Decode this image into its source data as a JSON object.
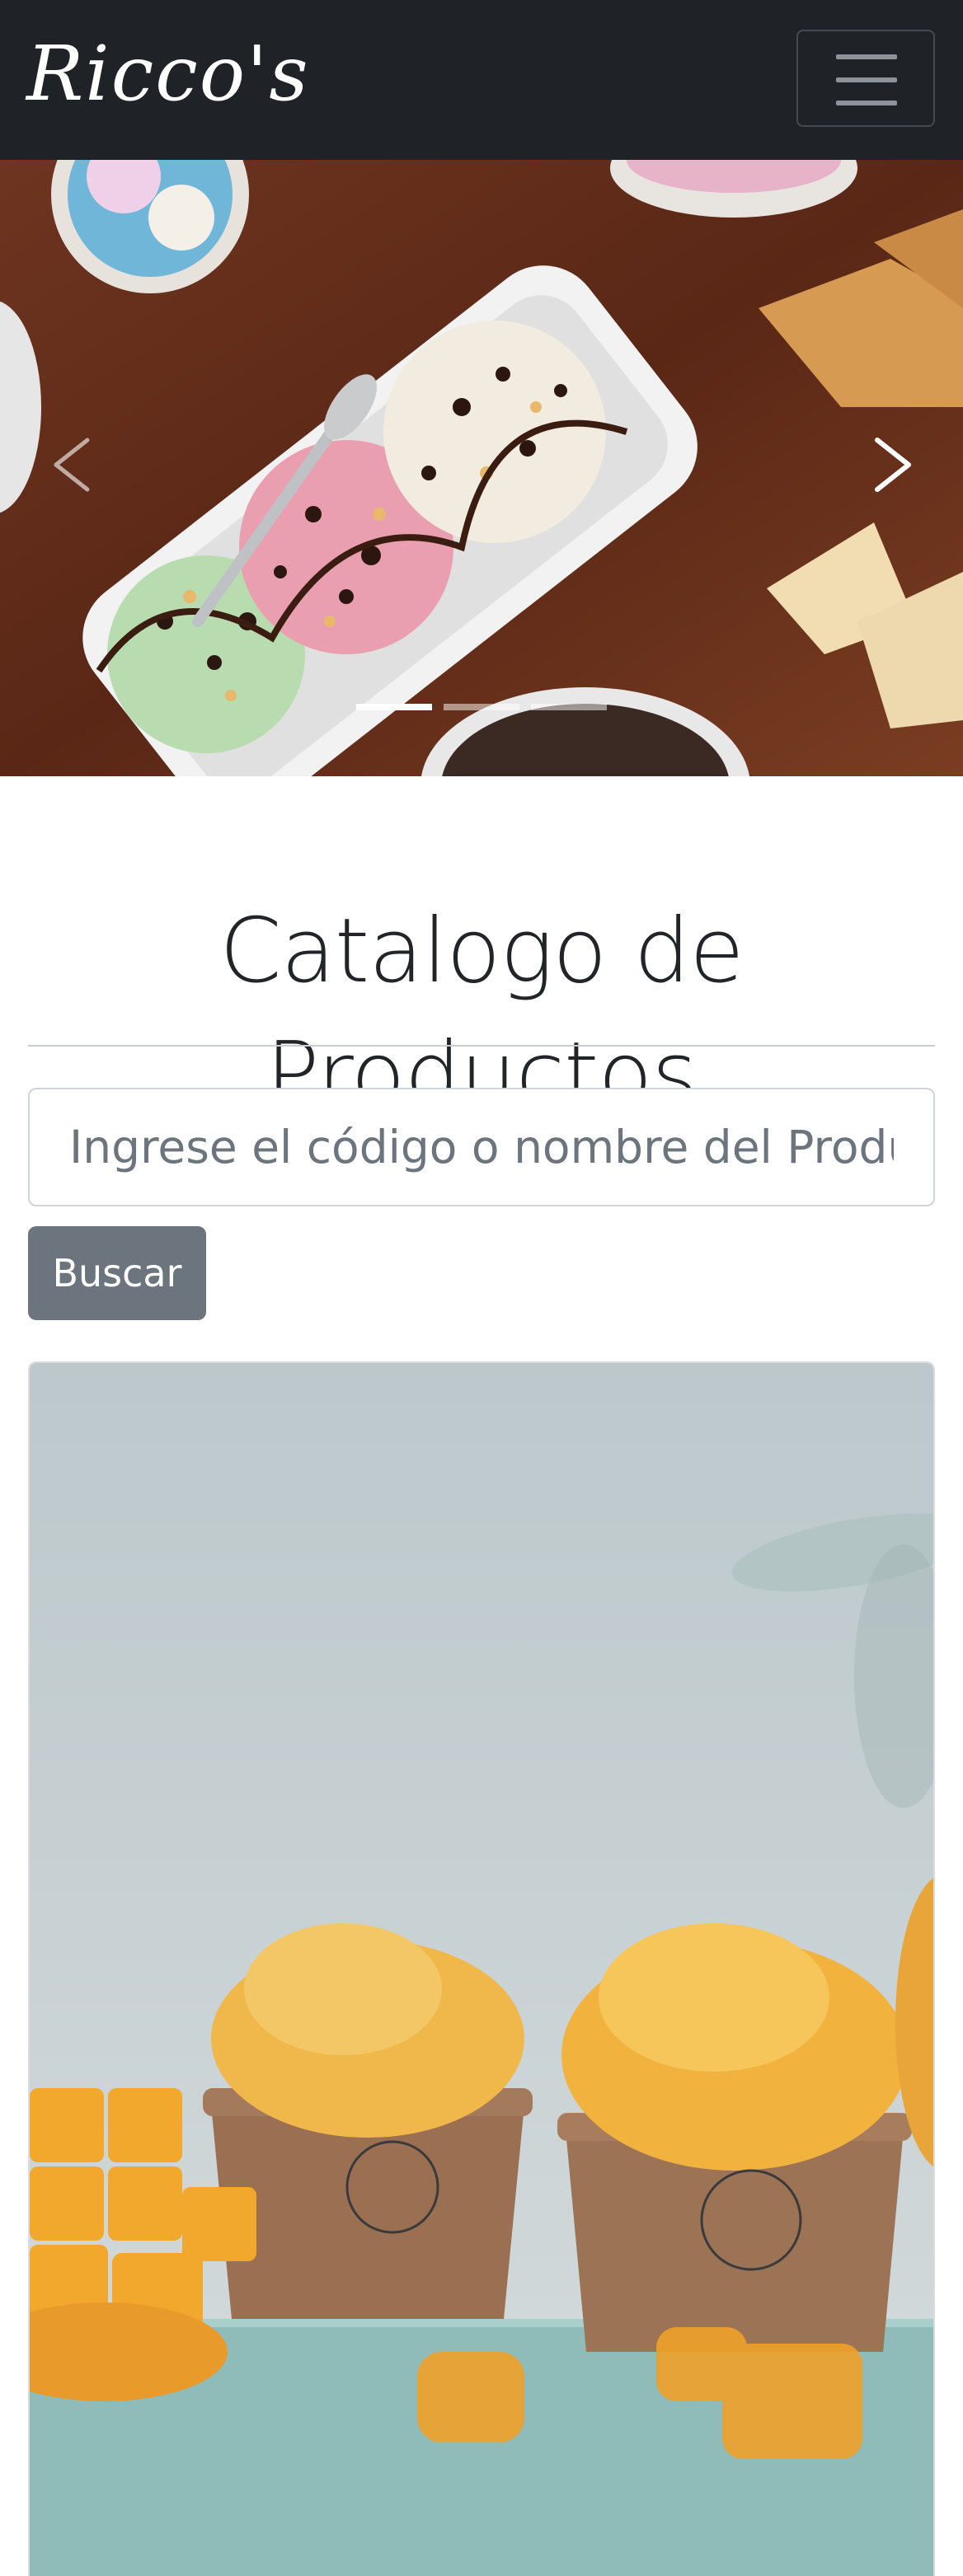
{
  "navbar": {
    "brand": "Ricco's",
    "toggler_icon": "hamburger-icon"
  },
  "carousel": {
    "slide_count": 3,
    "active_slide": 1,
    "prev_icon": "chevron-left-icon",
    "next_icon": "chevron-right-icon"
  },
  "catalog": {
    "title": "Catalogo de Productos",
    "search_placeholder": "Ingrese el código o nombre del Producto",
    "search_button": "Buscar"
  },
  "colors": {
    "navbar_bg": "#1f2328",
    "button_bg": "#6c757d",
    "text_dark": "#212529"
  }
}
